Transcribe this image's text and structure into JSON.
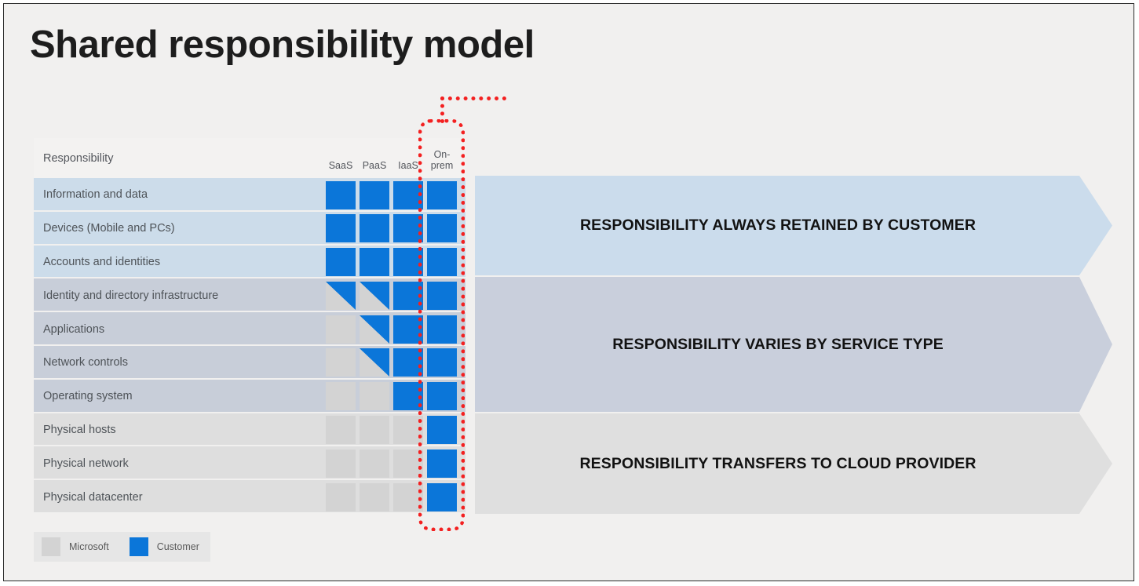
{
  "slide": {
    "title": "Shared responsibility model",
    "background_color": "#f1f0ef",
    "accent_customer_color": "#0b76d9",
    "accent_microsoft_color": "#d3d3d3",
    "annotation_color": "#f32020"
  },
  "table": {
    "headers": {
      "responsibility": "Responsibility",
      "columns": [
        {
          "label": "SaaS",
          "line1": "SaaS",
          "line2": ""
        },
        {
          "label": "PaaS",
          "line1": "PaaS",
          "line2": ""
        },
        {
          "label": "IaaS",
          "line1": "IaaS",
          "line2": ""
        },
        {
          "label": "On-prem",
          "line1": "On-",
          "line2": "prem"
        }
      ]
    },
    "rows": [
      {
        "label": "Information and data",
        "band": "a",
        "cells": [
          "cust",
          "cust",
          "cust",
          "cust"
        ]
      },
      {
        "label": "Devices (Mobile and PCs)",
        "band": "a",
        "cells": [
          "cust",
          "cust",
          "cust",
          "cust"
        ]
      },
      {
        "label": "Accounts and identities",
        "band": "a",
        "cells": [
          "cust",
          "cust",
          "cust",
          "cust"
        ]
      },
      {
        "label": "Identity and directory infrastructure",
        "band": "b",
        "cells": [
          "half",
          "half",
          "cust",
          "cust"
        ]
      },
      {
        "label": "Applications",
        "band": "b",
        "cells": [
          "ms",
          "half",
          "cust",
          "cust"
        ]
      },
      {
        "label": "Network controls",
        "band": "b",
        "cells": [
          "ms",
          "half",
          "cust",
          "cust"
        ]
      },
      {
        "label": "Operating system",
        "band": "b",
        "cells": [
          "ms",
          "ms",
          "cust",
          "cust"
        ]
      },
      {
        "label": "Physical hosts",
        "band": "c",
        "cells": [
          "ms",
          "ms",
          "ms",
          "cust"
        ]
      },
      {
        "label": "Physical network",
        "band": "c",
        "cells": [
          "ms",
          "ms",
          "ms",
          "cust"
        ]
      },
      {
        "label": "Physical datacenter",
        "band": "c",
        "cells": [
          "ms",
          "ms",
          "ms",
          "cust"
        ]
      }
    ]
  },
  "banners": [
    {
      "text": "RESPONSIBILITY ALWAYS RETAINED BY CUSTOMER",
      "color": "#cbdcec"
    },
    {
      "text": "RESPONSIBILITY VARIES BY SERVICE TYPE",
      "color": "#c9cfdc"
    },
    {
      "text": "RESPONSIBILITY TRANSFERS TO CLOUD PROVIDER",
      "color": "#dfdfdf"
    }
  ],
  "legend": [
    {
      "label": "Microsoft",
      "color": "#d3d3d3"
    },
    {
      "label": "Customer",
      "color": "#0b76d9"
    }
  ],
  "annotation": {
    "target_column": "On-prem",
    "shape": "dotted-rounded-rectangle"
  },
  "chart_data": {
    "type": "heatmap",
    "title": "Shared responsibility model",
    "xlabel": "",
    "ylabel": "Responsibility",
    "categories": [
      "SaaS",
      "PaaS",
      "IaaS",
      "On-prem"
    ],
    "rows": [
      "Information and data",
      "Devices (Mobile and PCs)",
      "Accounts and identities",
      "Identity and directory infrastructure",
      "Applications",
      "Network controls",
      "Operating system",
      "Physical hosts",
      "Physical network",
      "Physical datacenter"
    ],
    "value_legend": {
      "cust": "Customer",
      "ms": "Microsoft",
      "half": "Shared (Customer/Microsoft)"
    },
    "values": [
      [
        "cust",
        "cust",
        "cust",
        "cust"
      ],
      [
        "cust",
        "cust",
        "cust",
        "cust"
      ],
      [
        "cust",
        "cust",
        "cust",
        "cust"
      ],
      [
        "half",
        "half",
        "cust",
        "cust"
      ],
      [
        "ms",
        "half",
        "cust",
        "cust"
      ],
      [
        "ms",
        "half",
        "cust",
        "cust"
      ],
      [
        "ms",
        "ms",
        "cust",
        "cust"
      ],
      [
        "ms",
        "ms",
        "ms",
        "cust"
      ],
      [
        "ms",
        "ms",
        "ms",
        "cust"
      ],
      [
        "ms",
        "ms",
        "ms",
        "cust"
      ]
    ],
    "groups": [
      {
        "label": "RESPONSIBILITY ALWAYS RETAINED BY CUSTOMER",
        "rows": [
          0,
          1,
          2
        ]
      },
      {
        "label": "RESPONSIBILITY VARIES BY SERVICE TYPE",
        "rows": [
          3,
          4,
          5,
          6
        ]
      },
      {
        "label": "RESPONSIBILITY TRANSFERS TO CLOUD PROVIDER",
        "rows": [
          7,
          8,
          9
        ]
      }
    ],
    "legend_position": "bottom-left",
    "grid": false
  }
}
